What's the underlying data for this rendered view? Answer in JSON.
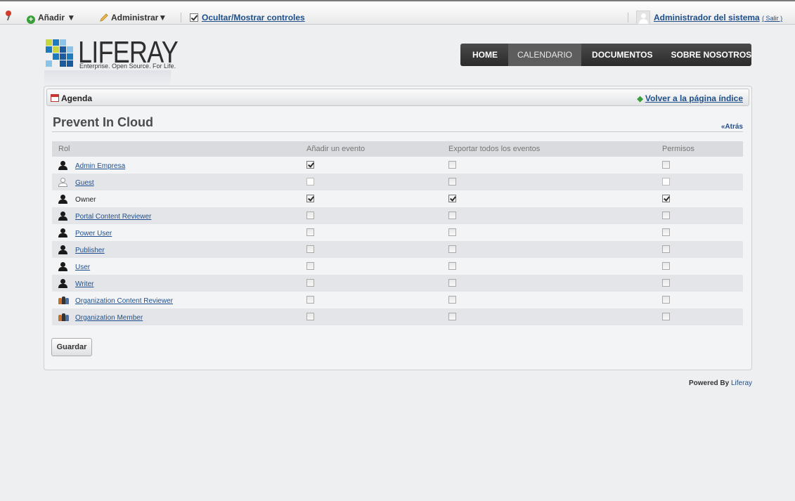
{
  "dock": {
    "add_label": "Añadir ▼",
    "manage_label": "Administrar▼",
    "toggle_controls_label": "Ocultar/Mostrar controles",
    "user_name": "Administrador del sistema",
    "signout_label": "( Salir )"
  },
  "logo": {
    "word": "LIFERAY",
    "tagline": "Enterprise. Open Source. For Life."
  },
  "nav": {
    "tabs": [
      {
        "label": "HOME",
        "active": false
      },
      {
        "label": "CALENDARIO",
        "active": true
      },
      {
        "label": "DOCUMENTOS",
        "active": false
      },
      {
        "label": "SOBRE NOSOTROS",
        "active": false
      }
    ]
  },
  "portlet": {
    "title": "Agenda",
    "back_to_index": "Volver a la página índice",
    "heading": "Prevent In Cloud",
    "back": "«Atrás",
    "save_label": "Guardar"
  },
  "table": {
    "headers": [
      "Rol",
      "Añadir un evento",
      "Exportar todos los eventos",
      "Permisos"
    ],
    "rows": [
      {
        "role": "Admin Empresa",
        "icon": "user-icon",
        "link": true,
        "add": true,
        "export": false,
        "perm": false
      },
      {
        "role": "Guest",
        "icon": "guest-user-icon",
        "link": true,
        "add": null,
        "export": false,
        "perm": null
      },
      {
        "role": "Owner",
        "icon": "user-icon",
        "link": false,
        "add": true,
        "export": true,
        "perm": true
      },
      {
        "role": "Portal Content Reviewer",
        "icon": "user-icon",
        "link": true,
        "add": false,
        "export": false,
        "perm": false
      },
      {
        "role": "Power User",
        "icon": "user-icon",
        "link": true,
        "add": false,
        "export": false,
        "perm": false
      },
      {
        "role": "Publisher",
        "icon": "user-icon",
        "link": true,
        "add": false,
        "export": false,
        "perm": false
      },
      {
        "role": "User",
        "icon": "user-icon",
        "link": true,
        "add": false,
        "export": false,
        "perm": false
      },
      {
        "role": "Writer",
        "icon": "user-icon",
        "link": true,
        "add": false,
        "export": false,
        "perm": false
      },
      {
        "role": "Organization Content Reviewer",
        "icon": "organization-icon",
        "link": true,
        "add": false,
        "export": false,
        "perm": false
      },
      {
        "role": "Organization Member",
        "icon": "organization-icon",
        "link": true,
        "add": false,
        "export": false,
        "perm": false
      }
    ]
  },
  "footer": {
    "powered_by": "Powered By",
    "powered_link": "Liferay"
  }
}
